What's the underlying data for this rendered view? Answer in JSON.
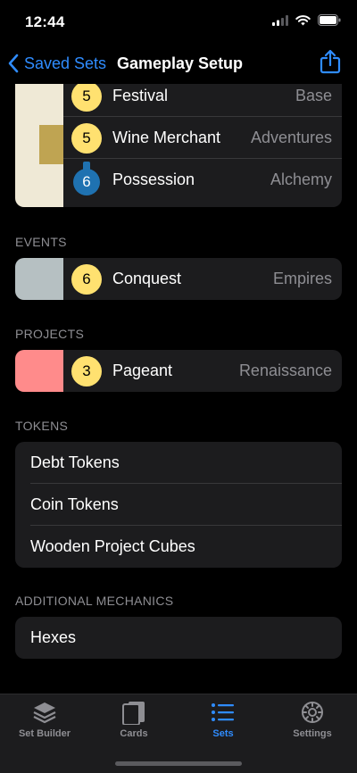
{
  "status_bar": {
    "time": "12:44"
  },
  "nav": {
    "back_label": "Saved Sets",
    "title": "Gameplay Setup"
  },
  "kingdom_partial": [
    {
      "cost": "5",
      "cost_type": "coin",
      "name": "Festival",
      "set": "Base"
    },
    {
      "cost": "5",
      "cost_type": "coin",
      "name": "Wine Merchant",
      "set": "Adventures"
    },
    {
      "cost": "6",
      "cost_type": "potion",
      "name": "Possession",
      "set": "Alchemy"
    }
  ],
  "events": {
    "header": "EVENTS",
    "items": [
      {
        "cost": "6",
        "name": "Conquest",
        "set": "Empires",
        "swatch_color": "#b6c0c2"
      }
    ]
  },
  "projects": {
    "header": "PROJECTS",
    "items": [
      {
        "cost": "3",
        "name": "Pageant",
        "set": "Renaissance",
        "swatch_color": "#ff8b8b"
      }
    ]
  },
  "tokens": {
    "header": "TOKENS",
    "items": [
      "Debt Tokens",
      "Coin Tokens",
      "Wooden Project Cubes"
    ]
  },
  "additional_mechanics": {
    "header": "ADDITIONAL MECHANICS",
    "items": [
      "Hexes"
    ]
  },
  "tab_bar": {
    "tabs": [
      {
        "label": "Set Builder",
        "icon": "stack-icon",
        "active": false
      },
      {
        "label": "Cards",
        "icon": "cards-icon",
        "active": false
      },
      {
        "label": "Sets",
        "icon": "list-icon",
        "active": true
      },
      {
        "label": "Settings",
        "icon": "gear-icon",
        "active": false
      }
    ]
  },
  "colors": {
    "accent": "#2f8cff",
    "coin": "#ffe170",
    "potion": "#1f72b1",
    "cell_bg": "#1c1c1e",
    "kingdom_swatch_light": "#efe9d6",
    "kingdom_swatch_gold": "#bfa452"
  }
}
